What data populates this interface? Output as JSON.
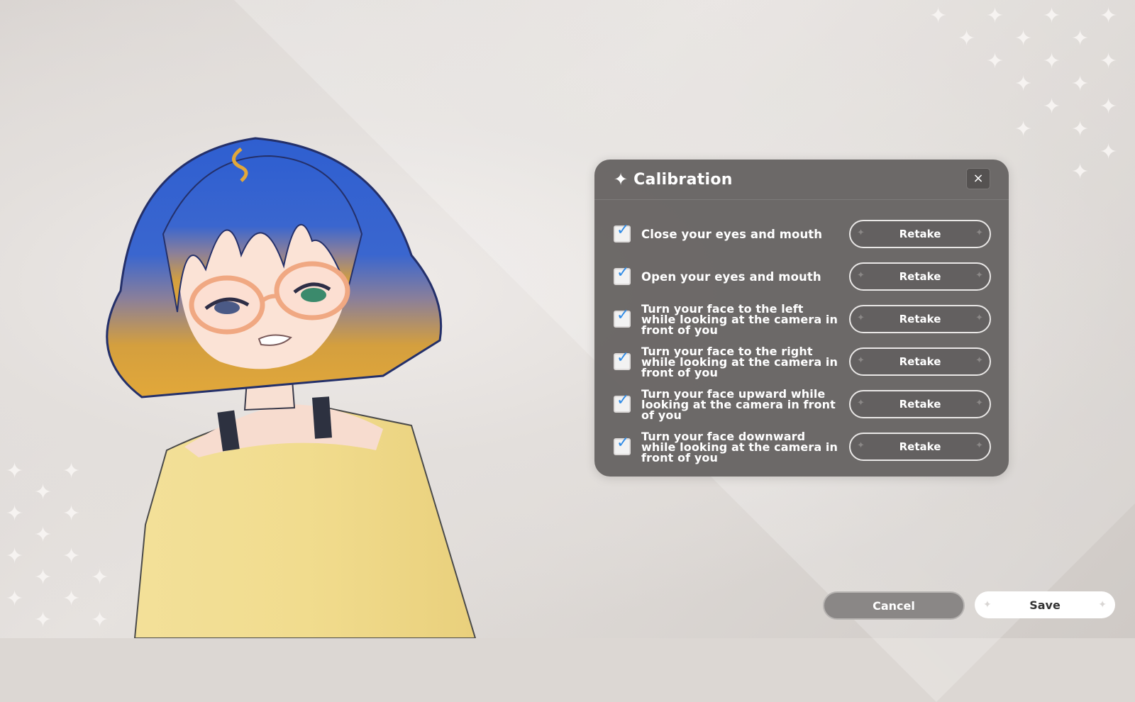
{
  "panel": {
    "title": "Calibration",
    "close_symbol": "×",
    "items": [
      {
        "label": "Close your eyes and mouth",
        "checked": true,
        "button": "Retake"
      },
      {
        "label": "Open your eyes and mouth",
        "checked": true,
        "button": "Retake"
      },
      {
        "label": "Turn your face to the left while looking at the camera in front of you",
        "checked": true,
        "button": "Retake"
      },
      {
        "label": "Turn your face to the right while looking at the camera in front of you",
        "checked": true,
        "button": "Retake"
      },
      {
        "label": "Turn your face upward while looking at the camera in front of you",
        "checked": true,
        "button": "Retake"
      },
      {
        "label": "Turn your face downward while looking at the camera in front of you",
        "checked": true,
        "button": "Retake"
      }
    ]
  },
  "footer": {
    "cancel_label": "Cancel",
    "save_label": "Save"
  },
  "icons": {
    "title": "sparkle-icon",
    "close": "close-icon",
    "check": "checkmark-icon"
  },
  "colors": {
    "panel": "#676463",
    "check_accent": "#2f8be6",
    "hair_top": "#3566cf",
    "hair_tip": "#e2a83a",
    "sweater": "#f1dc8e"
  }
}
